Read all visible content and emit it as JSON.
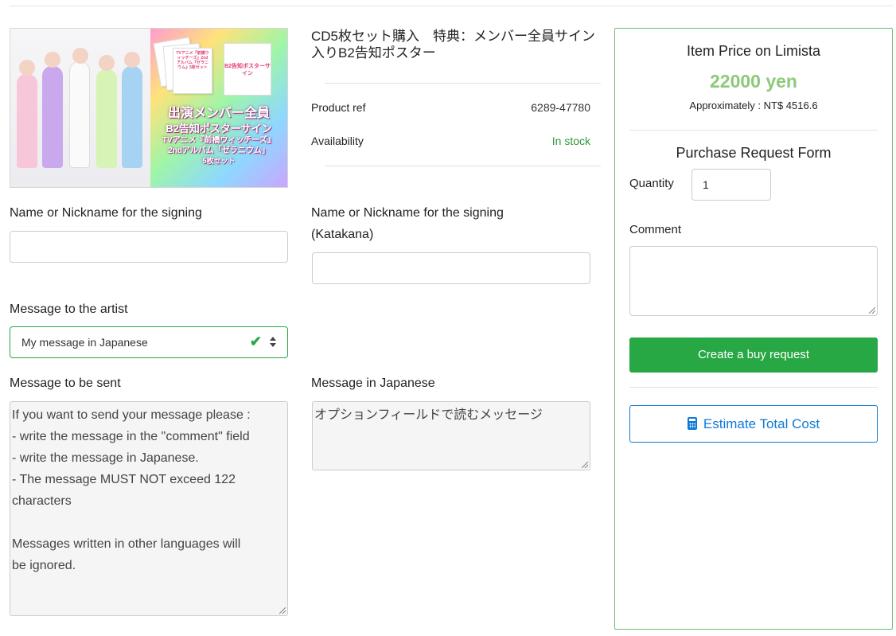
{
  "product": {
    "title": "CD5枚セット購入　特典：メンバー全員サイン入りB2告知ポスター",
    "ref_label": "Product ref",
    "ref_value": "6289-47780",
    "availability_label": "Availability",
    "availability_value": "In stock",
    "image": {
      "poster_text": "B2告知ポスターサイン",
      "card_text": "TVアニメ『前橋ウィッチーズ』2ndアルバム『ゼラニウム』5枚セット",
      "caption_line1": "出演メンバー全員",
      "caption_line2": "B2告知ポスターサイン",
      "caption_line3": "TVアニメ『前橋ウィッチーズ』",
      "caption_line4": "2ndアルバム「ゼラニウム」",
      "caption_line5": "5枚セット"
    }
  },
  "form": {
    "name_label": "Name or Nickname for the signing",
    "name_value": "",
    "katakana_label_line1": "Name or Nickname for the signing",
    "katakana_label_line2": "(Katakana)",
    "katakana_value": "",
    "message_artist_label": "Message to the artist",
    "message_artist_selected": "My message in Japanese",
    "message_sent_label": "Message to be sent",
    "message_sent_lines": [
      "If you want to send your message please :",
      "- write the message in the \"comment\" field",
      "- write the message in Japanese.",
      "- The message MUST NOT exceed 122",
      "characters",
      "",
      "Messages written in other languages will",
      "be ignored."
    ],
    "message_japanese_label": "Message in Japanese",
    "message_japanese_value": "オプションフィールドで読むメッセージ"
  },
  "purchase": {
    "price_heading": "Item Price on Limista",
    "price": "22000 yen",
    "approx": "Approximately : NT$ 4516.6",
    "form_heading": "Purchase Request Form",
    "quantity_label": "Quantity",
    "quantity_value": "1",
    "comment_label": "Comment",
    "comment_value": "",
    "buy_button": "Create a buy request",
    "estimate_button": "Estimate Total Cost"
  },
  "colors": {
    "accent_green": "#28a745",
    "price_green": "#8cc97a",
    "stock_green": "#2d9a3a",
    "estimate_blue": "#0f7ad6"
  }
}
